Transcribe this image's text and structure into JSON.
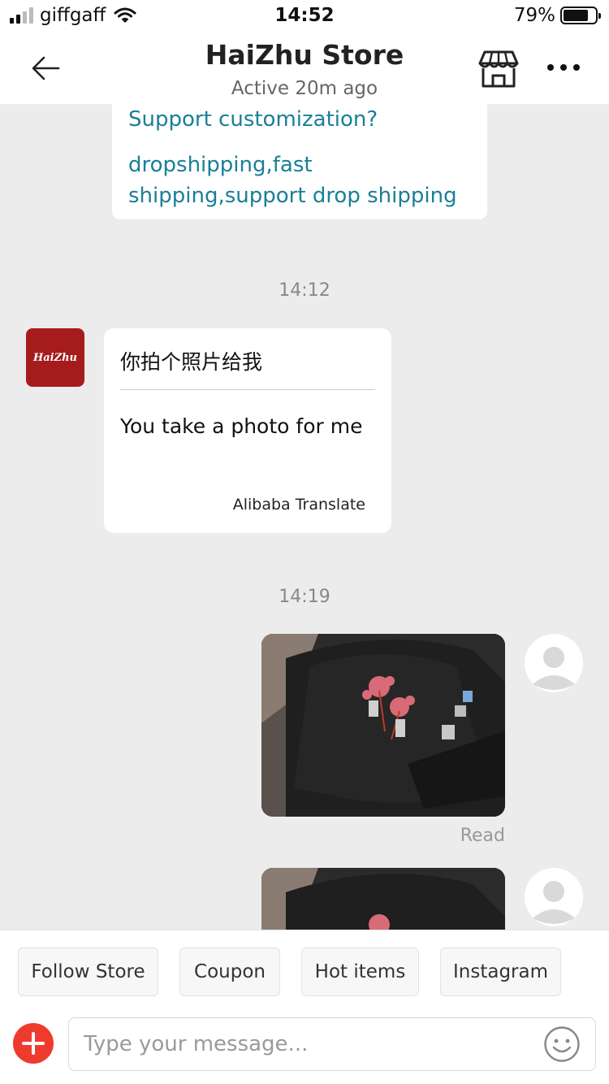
{
  "status_bar": {
    "carrier": "giffgaff",
    "time": "14:52",
    "battery": "79%",
    "battery_level": 0.79
  },
  "header": {
    "title": "HaiZhu Store",
    "subtitle": "Active 20m ago",
    "back_icon": "back-arrow-icon",
    "store_icon": "storefront-icon",
    "more_icon": "more-dots-icon"
  },
  "messages": {
    "partial_bubble": {
      "line1": "Support customization?",
      "line2": "dropshipping,fast shipping,support drop shipping"
    },
    "time_1": "14:12",
    "store_message": {
      "avatar_text": "HaiZhu",
      "original": "你拍个照片给我",
      "translated": "You take a photo for me",
      "translator": "Alibaba Translate"
    },
    "time_2": "14:19",
    "read_status": "Read"
  },
  "quick_replies": [
    "Follow Store",
    "Coupon",
    "Hot items",
    "Instagram"
  ],
  "composer": {
    "placeholder": "Type your message...",
    "add_icon": "plus-icon",
    "emoji_icon": "smiley-icon"
  },
  "colors": {
    "link": "#1a7f97",
    "accent": "#ef3b2d",
    "store_avatar": "#a61c1c",
    "chat_bg": "#ececec"
  }
}
